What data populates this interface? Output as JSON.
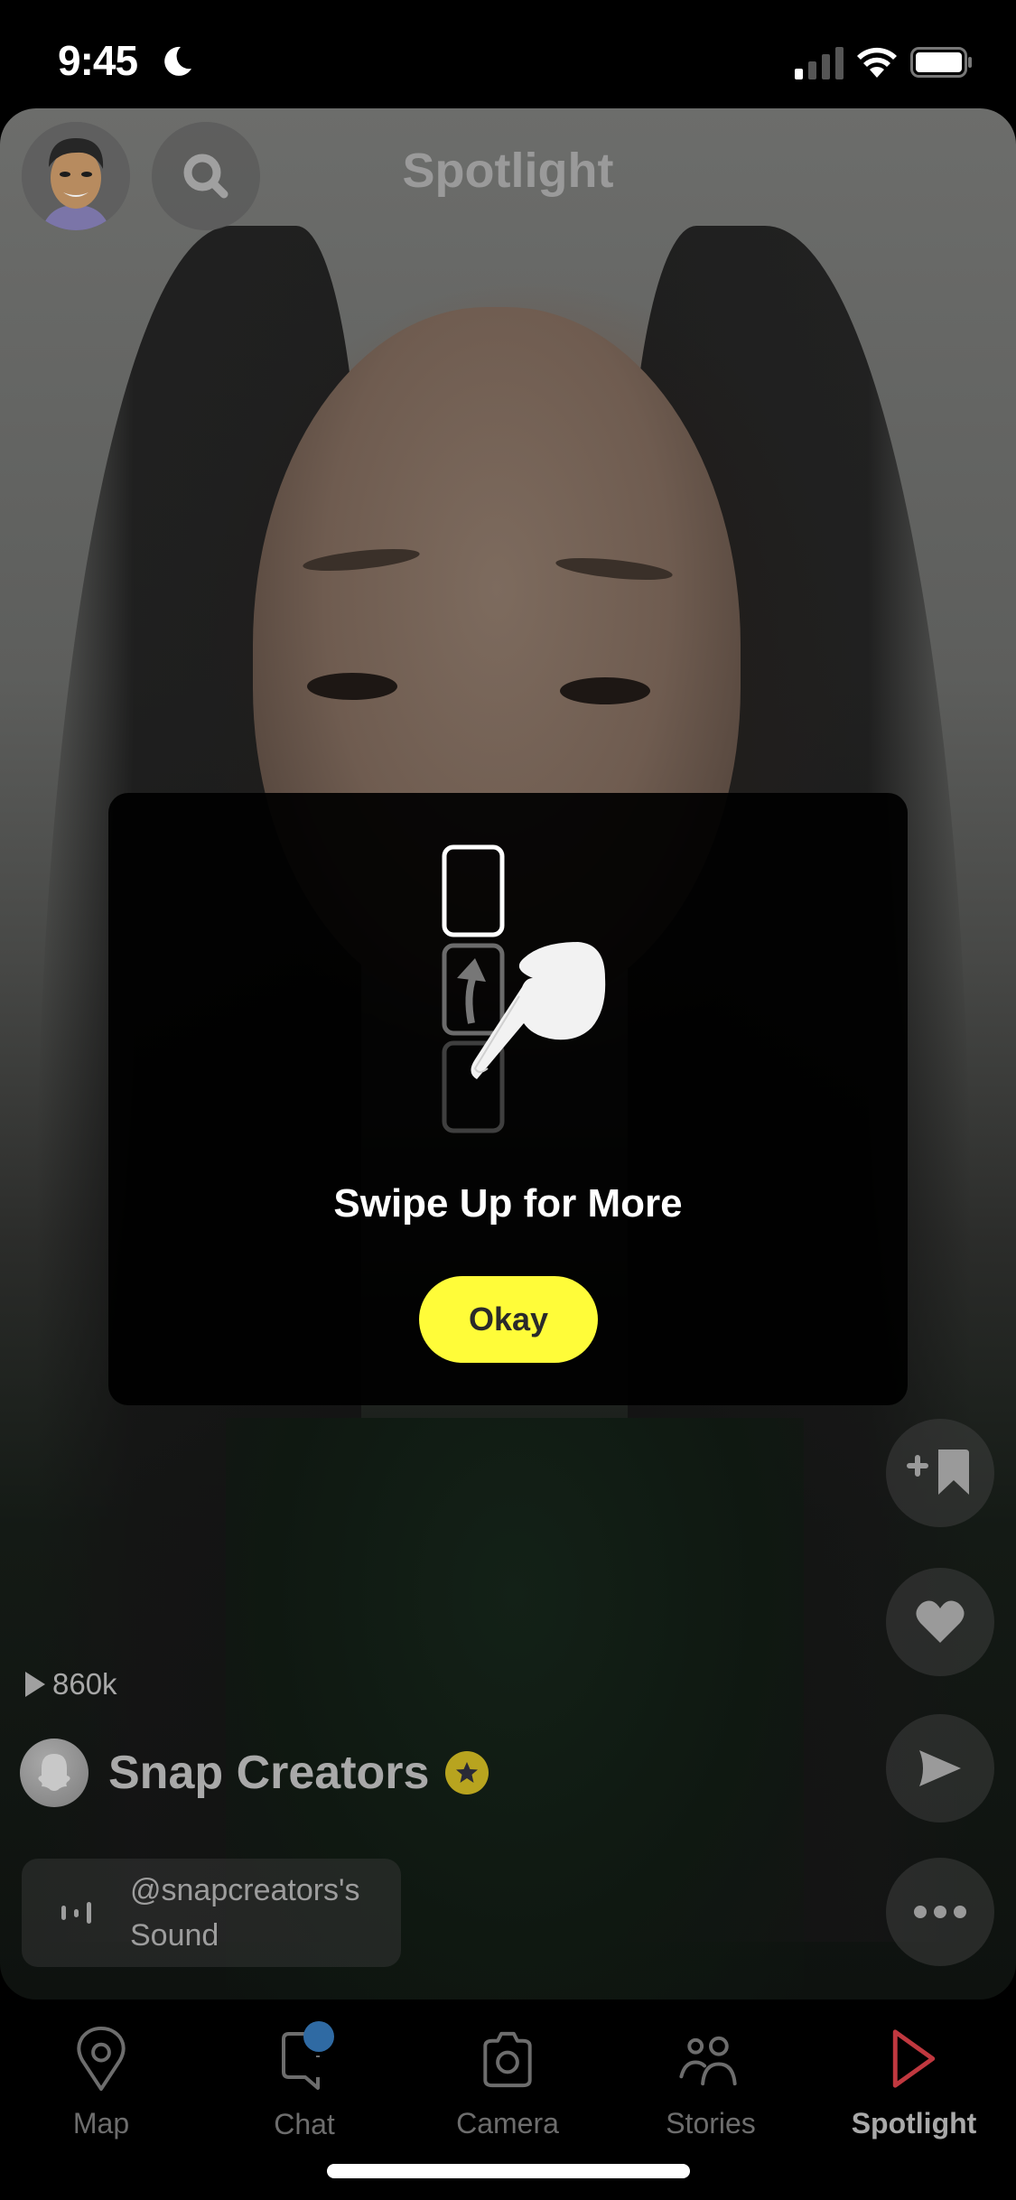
{
  "status_bar": {
    "time": "9:45",
    "focus_icon": "moon-icon",
    "signal_icon": "cellular-signal-icon",
    "wifi_icon": "wifi-icon",
    "battery_icon": "battery-icon"
  },
  "header": {
    "title": "Spotlight",
    "avatar_icon": "bitmoji-avatar",
    "search_icon": "search-icon"
  },
  "modal": {
    "title": "Swipe Up for More",
    "okay_label": "Okay",
    "illustration": "swipe-up-hand-illustration",
    "accent_color": "#fffc39"
  },
  "actions": [
    {
      "name": "add-to-favorites",
      "icon": "bookmark-plus-icon"
    },
    {
      "name": "like",
      "icon": "heart-icon"
    },
    {
      "name": "share",
      "icon": "send-arrow-icon"
    },
    {
      "name": "more",
      "icon": "more-dots-icon"
    }
  ],
  "post": {
    "views": "860k",
    "creator_name": "Snap Creators",
    "creator_badge": "star-badge",
    "sound_line1": "@snapcreators's",
    "sound_line2": "Sound"
  },
  "nav": {
    "items": [
      {
        "label": "Map",
        "icon": "map-pin-icon",
        "active": false
      },
      {
        "label": "Chat",
        "icon": "chat-icon",
        "active": false,
        "badge": true
      },
      {
        "label": "Camera",
        "icon": "camera-icon",
        "active": false
      },
      {
        "label": "Stories",
        "icon": "stories-icon",
        "active": false
      },
      {
        "label": "Spotlight",
        "icon": "spotlight-play-icon",
        "active": true
      }
    ],
    "active_color": "#c0383f",
    "badge_color": "#2f6aa3"
  }
}
